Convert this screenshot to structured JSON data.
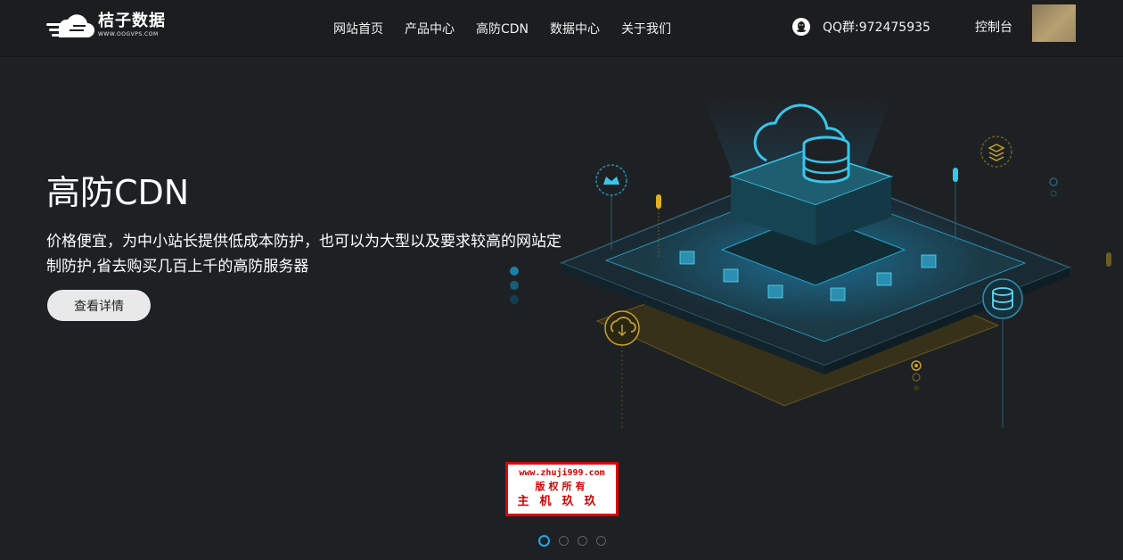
{
  "brand": {
    "name": "桔子数据",
    "domain": "WWW.OOGVPS.COM",
    "logo_icon": "cloud-speed-icon"
  },
  "nav": {
    "items": [
      {
        "label": "网站首页"
      },
      {
        "label": "产品中心"
      },
      {
        "label": "高防CDN"
      },
      {
        "label": "数据中心"
      },
      {
        "label": "关于我们"
      }
    ]
  },
  "contact": {
    "icon": "qq-penguin-icon",
    "text": "QQ群:972475935"
  },
  "account": {
    "console_label": "控制台"
  },
  "hero": {
    "title": "高防CDN",
    "description": "价格便宜，为中小站长提供低成本防护，也可以为大型以及要求较高的网站定制防护,省去购买几百上千的高防服务器",
    "button_label": "查看详情"
  },
  "watermark": {
    "line1": "www.zhuji999.com",
    "line2": "版权所有",
    "line3": "主机玖玖"
  },
  "carousel": {
    "slide_count": 4,
    "active_index": 0
  },
  "colors": {
    "background": "#1e2124",
    "header": "#1c1d1f",
    "accent_cyan": "#1ea8e8",
    "accent_gold": "#c8a227",
    "watermark_red": "#e00000"
  }
}
